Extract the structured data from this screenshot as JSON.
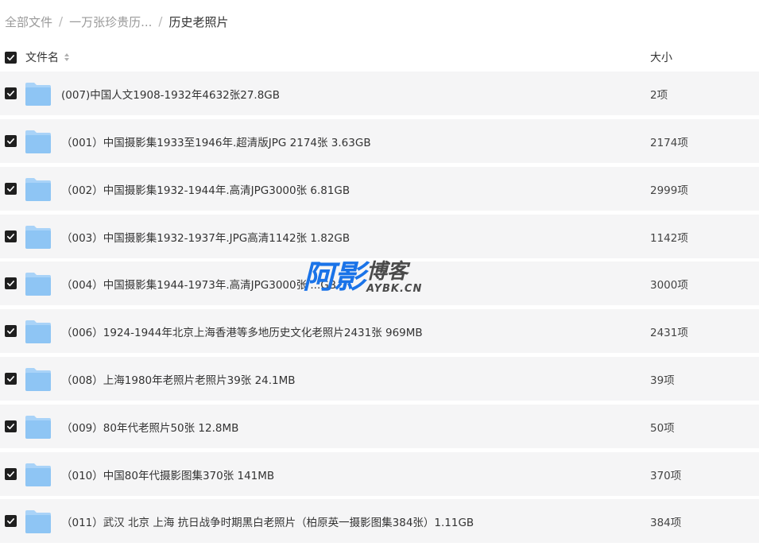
{
  "breadcrumb": {
    "items": [
      "全部文件",
      "一万张珍贵历...",
      "历史老照片"
    ],
    "separator": "/"
  },
  "header": {
    "name_label": "文件名",
    "size_label": "大小"
  },
  "rows": [
    {
      "name": "(007)中国人文1908-1932年4632张27.8GB",
      "count": "2项"
    },
    {
      "name": "（001）中国摄影集1933至1946年.超清版JPG 2174张 3.63GB",
      "count": "2174项"
    },
    {
      "name": "（002）中国摄影集1932-1944年.高清JPG3000张 6.81GB",
      "count": "2999项"
    },
    {
      "name": "（003）中国摄影集1932-1937年.JPG高清1142张 1.82GB",
      "count": "1142项"
    },
    {
      "name": "（004）中国摄影集1944-1973年.高清JPG3000张 ...GB",
      "count": "3000项"
    },
    {
      "name": "（006）1924-1944年北京上海香港等多地历史文化老照片2431张 969MB",
      "count": "2431项"
    },
    {
      "name": "（008）上海1980年老照片老照片39张 24.1MB",
      "count": "39项"
    },
    {
      "name": "（009）80年代老照片50张 12.8MB",
      "count": "50项"
    },
    {
      "name": "（010）中国80年代摄影图集370张 141MB",
      "count": "370项"
    },
    {
      "name": "（011）武汉 北京 上海 抗日战争时期黑白老照片（柏原英一摄影图集384张）1.11GB",
      "count": "384项"
    }
  ],
  "watermark": {
    "main": "阿影",
    "side": "博客",
    "url": "AYBK.CN"
  },
  "colors": {
    "row_bg": "#f5f5f6",
    "checkbox": "#1f1f1f",
    "folder": "#8ec5f4",
    "watermark_blue": "#1a73e8"
  }
}
